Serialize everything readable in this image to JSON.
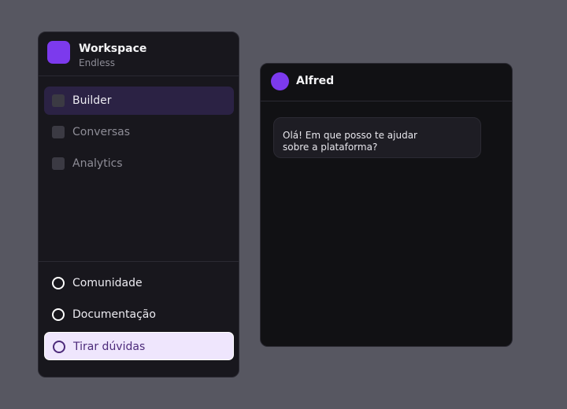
{
  "workspace": {
    "title": "Workspace",
    "subtitle": "Endless",
    "logo_color": "#7c3aed"
  },
  "sidebar": {
    "items": [
      {
        "label": "Builder",
        "icon": "square-icon",
        "active": true
      },
      {
        "label": "Conversas",
        "icon": "square-icon",
        "active": false
      },
      {
        "label": "Analytics",
        "icon": "square-icon",
        "active": false
      }
    ],
    "footer_items": [
      {
        "label": "Comunidade",
        "icon": "circle-icon"
      },
      {
        "label": "Documentação",
        "icon": "circle-icon"
      },
      {
        "label": "Tirar dúvidas",
        "icon": "circle-icon",
        "highlighted": true
      }
    ]
  },
  "chat": {
    "assistant_name": "Alfred",
    "avatar_color": "#7c3aed",
    "messages": [
      {
        "from": "assistant",
        "text": "Olá! Em que posso te ajudar\nsobre a plataforma?"
      }
    ]
  },
  "colors": {
    "background": "#575761",
    "panel": "#18171d",
    "accent": "#7c3aed",
    "highlight_bg": "#efe6fd"
  }
}
